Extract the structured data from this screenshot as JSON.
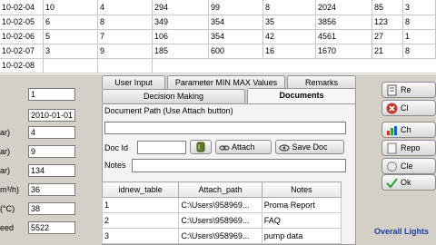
{
  "bg_table": {
    "rows": [
      [
        "10-02-04",
        "10",
        "4",
        "294",
        "99",
        "8",
        "2024",
        "85",
        "3"
      ],
      [
        "10-02-05",
        "6",
        "8",
        "349",
        "354",
        "35",
        "3856",
        "123",
        "8"
      ],
      [
        "10-02-06",
        "5",
        "7",
        "106",
        "354",
        "42",
        "4561",
        "27",
        "1"
      ],
      [
        "10-02-07",
        "3",
        "9",
        "185",
        "600",
        "16",
        "1670",
        "21",
        "8"
      ],
      [
        "10-02-08",
        "",
        "",
        "",
        "",
        "",
        "",
        "",
        ""
      ]
    ]
  },
  "left": {
    "labels": [
      "",
      "",
      "ar)",
      "ar)",
      "ar)",
      "m³/h)",
      "(°C)",
      "eed"
    ],
    "values": [
      "1",
      "2010-01-01",
      "4",
      "9",
      "134",
      "36",
      "38",
      "5522"
    ]
  },
  "tabs": {
    "row1": [
      "User Input",
      "Parameter MIN MAX Values",
      "Remarks"
    ],
    "row2": [
      "Decision Making",
      "Documents"
    ]
  },
  "documents": {
    "path_label": "Document Path (Use Attach button)",
    "path_value": "",
    "docid_label": "Doc Id",
    "docid_value": "",
    "attach_label": "Attach",
    "save_label": "Save Doc",
    "notes_label": "Notes",
    "notes_value": "",
    "table": {
      "headers": [
        "idnew_table",
        "Attach_path",
        "Notes"
      ],
      "rows": [
        [
          "1",
          "C:\\Users\\958969...",
          "Proma Report"
        ],
        [
          "2",
          "C:\\Users\\958969...",
          "FAQ"
        ],
        [
          "3",
          "C:\\Users\\958969...",
          "pump data"
        ]
      ]
    }
  },
  "right": {
    "buttons": [
      "Re",
      "Cl",
      "Ch",
      "Repo",
      "Cle",
      "Ok"
    ],
    "overall_lights": "Overall Lights"
  },
  "colors": {
    "accent_blue": "#1c3f9c",
    "close_red": "#c0392b",
    "ok_green": "#2e9e3e"
  }
}
